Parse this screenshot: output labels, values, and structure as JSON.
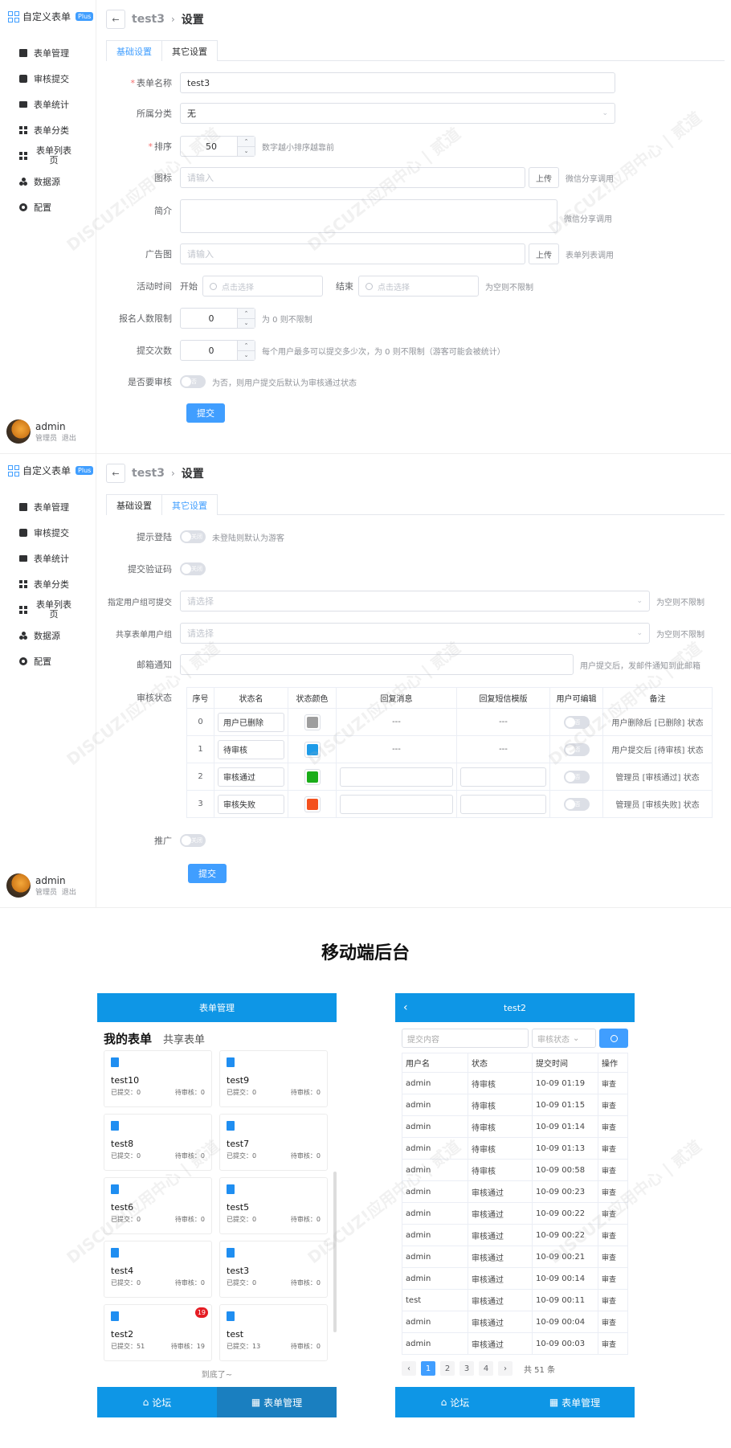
{
  "sidebar": {
    "app_title": "自定义表单",
    "badge": "Plus",
    "items": [
      {
        "label": "表单管理",
        "icon": "document-icon"
      },
      {
        "label": "审核提交",
        "icon": "check-icon"
      },
      {
        "label": "表单统计",
        "icon": "monitor-icon"
      },
      {
        "label": "表单分类",
        "icon": "grid-icon"
      },
      {
        "label": "表单列表页",
        "icon": "list-icon"
      },
      {
        "label": "数据源",
        "icon": "nodes-icon"
      },
      {
        "label": "配置",
        "icon": "gear-icon"
      }
    ],
    "user": {
      "name": "admin",
      "role": "管理员",
      "logout": "退出"
    }
  },
  "header": {
    "back": "←",
    "form_name": "test3",
    "sep": "›",
    "page": "设置"
  },
  "tabs": [
    "基础设置",
    "其它设置"
  ],
  "basic": {
    "name": {
      "label": "表单名称",
      "value": "test3"
    },
    "category": {
      "label": "所属分类",
      "value": "无"
    },
    "sort": {
      "label": "排序",
      "value": "50",
      "hint": "数字越小排序越靠前"
    },
    "icon": {
      "label": "图标",
      "placeholder": "请输入",
      "button": "上传",
      "hint": "微信分享调用"
    },
    "intro": {
      "label": "简介",
      "hint": "微信分享调用"
    },
    "ad": {
      "label": "广告图",
      "placeholder": "请输入",
      "button": "上传",
      "hint": "表单列表调用"
    },
    "time": {
      "label": "活动时间",
      "start": "开始",
      "end": "结束",
      "placeholder": "点击选择",
      "hint": "为空则不限制"
    },
    "limit": {
      "label": "报名人数限制",
      "value": "0",
      "hint": "为 0 则不限制"
    },
    "times": {
      "label": "提交次数",
      "value": "0",
      "hint": "每个用户最多可以提交多少次，为 0 则不限制（游客可能会被统计）"
    },
    "audit": {
      "label": "是否要审核",
      "switch": "否",
      "hint": "为否，则用户提交后默认为审核通过状态"
    },
    "submit": "提交"
  },
  "other": {
    "login": {
      "label": "提示登陆",
      "switch": "关闭",
      "hint": "未登陆则默认为游客"
    },
    "captcha": {
      "label": "提交验证码",
      "switch": "关闭"
    },
    "group": {
      "label": "指定用户组可提交",
      "placeholder": "请选择",
      "hint": "为空则不限制"
    },
    "share": {
      "label": "共享表单用户组",
      "placeholder": "请选择",
      "hint": "为空则不限制"
    },
    "mail": {
      "label": "邮箱通知",
      "hint": "用户提交后，发邮件通知到此邮箱"
    },
    "status_label": "审核状态",
    "status_cols": [
      "序号",
      "状态名",
      "状态颜色",
      "回复消息",
      "回复短信模版",
      "用户可编辑",
      "备注"
    ],
    "status_rows": [
      {
        "no": "0",
        "name": "用户已删除",
        "color": "#9e9e9e",
        "reply": "---",
        "sms": "---",
        "switch": "否",
        "note": "用户删除后 [已删除] 状态"
      },
      {
        "no": "1",
        "name": "待审核",
        "color": "#1e9be8",
        "reply": "---",
        "sms": "---",
        "switch": "否",
        "note": "用户提交后 [待审核] 状态"
      },
      {
        "no": "2",
        "name": "审核通过",
        "color": "#1aad19",
        "reply": "",
        "sms": "",
        "switch": "否",
        "note": "管理员 [审核通过] 状态"
      },
      {
        "no": "3",
        "name": "审核失败",
        "color": "#f4511e",
        "reply": "",
        "sms": "",
        "switch": "否",
        "note": "管理员 [审核失败] 状态"
      }
    ],
    "promote": {
      "label": "推广",
      "switch": "关闭"
    },
    "submit": "提交"
  },
  "mobile_heading": "移动端后台",
  "mobile_list": {
    "title": "表单管理",
    "tab_mine": "我的表单",
    "tab_shared": "共享表单",
    "cards": [
      {
        "name": "test10",
        "sub": "已提交：0",
        "pend": "待审核：0",
        "badge": ""
      },
      {
        "name": "test9",
        "sub": "已提交：0",
        "pend": "待审核：0",
        "badge": ""
      },
      {
        "name": "test8",
        "sub": "已提交：0",
        "pend": "待审核：0",
        "badge": ""
      },
      {
        "name": "test7",
        "sub": "已提交：0",
        "pend": "待审核：0",
        "badge": ""
      },
      {
        "name": "test6",
        "sub": "已提交：0",
        "pend": "待审核：0",
        "badge": ""
      },
      {
        "name": "test5",
        "sub": "已提交：0",
        "pend": "待审核：0",
        "badge": ""
      },
      {
        "name": "test4",
        "sub": "已提交：0",
        "pend": "待审核：0",
        "badge": ""
      },
      {
        "name": "test3",
        "sub": "已提交：0",
        "pend": "待审核：0",
        "badge": ""
      },
      {
        "name": "test2",
        "sub": "已提交：51",
        "pend": "待审核：19",
        "badge": "19"
      },
      {
        "name": "test",
        "sub": "已提交：13",
        "pend": "待审核：0",
        "badge": ""
      }
    ],
    "end": "到底了~",
    "footer": [
      {
        "label": "论坛",
        "icon": "home-icon"
      },
      {
        "label": "表单管理",
        "icon": "grid-icon"
      }
    ]
  },
  "mobile_detail": {
    "title": "test2",
    "back": "‹",
    "search_placeholder": "提交内容",
    "filter": "审核状态",
    "cols": [
      "用户名",
      "状态",
      "提交时间",
      "操作"
    ],
    "rows": [
      {
        "user": "admin",
        "status": "待审核",
        "st": "pend",
        "time": "10-09 01:19",
        "op": "审查"
      },
      {
        "user": "admin",
        "status": "待审核",
        "st": "pend",
        "time": "10-09 01:15",
        "op": "审查"
      },
      {
        "user": "admin",
        "status": "待审核",
        "st": "pend",
        "time": "10-09 01:14",
        "op": "审查"
      },
      {
        "user": "admin",
        "status": "待审核",
        "st": "pend",
        "time": "10-09 01:13",
        "op": "审查"
      },
      {
        "user": "admin",
        "status": "待审核",
        "st": "pend",
        "time": "10-09 00:58",
        "op": "审查"
      },
      {
        "user": "admin",
        "status": "审核通过",
        "st": "ok",
        "time": "10-09 00:23",
        "op": "审查"
      },
      {
        "user": "admin",
        "status": "审核通过",
        "st": "ok",
        "time": "10-09 00:22",
        "op": "审查"
      },
      {
        "user": "admin",
        "status": "审核通过",
        "st": "ok",
        "time": "10-09 00:22",
        "op": "审查"
      },
      {
        "user": "admin",
        "status": "审核通过",
        "st": "ok",
        "time": "10-09 00:21",
        "op": "审查"
      },
      {
        "user": "admin",
        "status": "审核通过",
        "st": "ok",
        "time": "10-09 00:14",
        "op": "审查"
      },
      {
        "user": "test",
        "status": "审核通过",
        "st": "ok",
        "time": "10-09 00:11",
        "op": "审查"
      },
      {
        "user": "admin",
        "status": "审核通过",
        "st": "ok",
        "time": "10-09 00:04",
        "op": "审查"
      },
      {
        "user": "admin",
        "status": "审核通过",
        "st": "ok",
        "time": "10-09 00:03",
        "op": "审查"
      }
    ],
    "pages": [
      "1",
      "2",
      "3",
      "4"
    ],
    "prev": "‹",
    "next": "›",
    "total": "共 51 条",
    "footer": [
      {
        "label": "论坛",
        "icon": "home-icon"
      },
      {
        "label": "表单管理",
        "icon": "grid-icon"
      }
    ]
  },
  "watermark": "DISCUZ!应用中心 | 贰道"
}
